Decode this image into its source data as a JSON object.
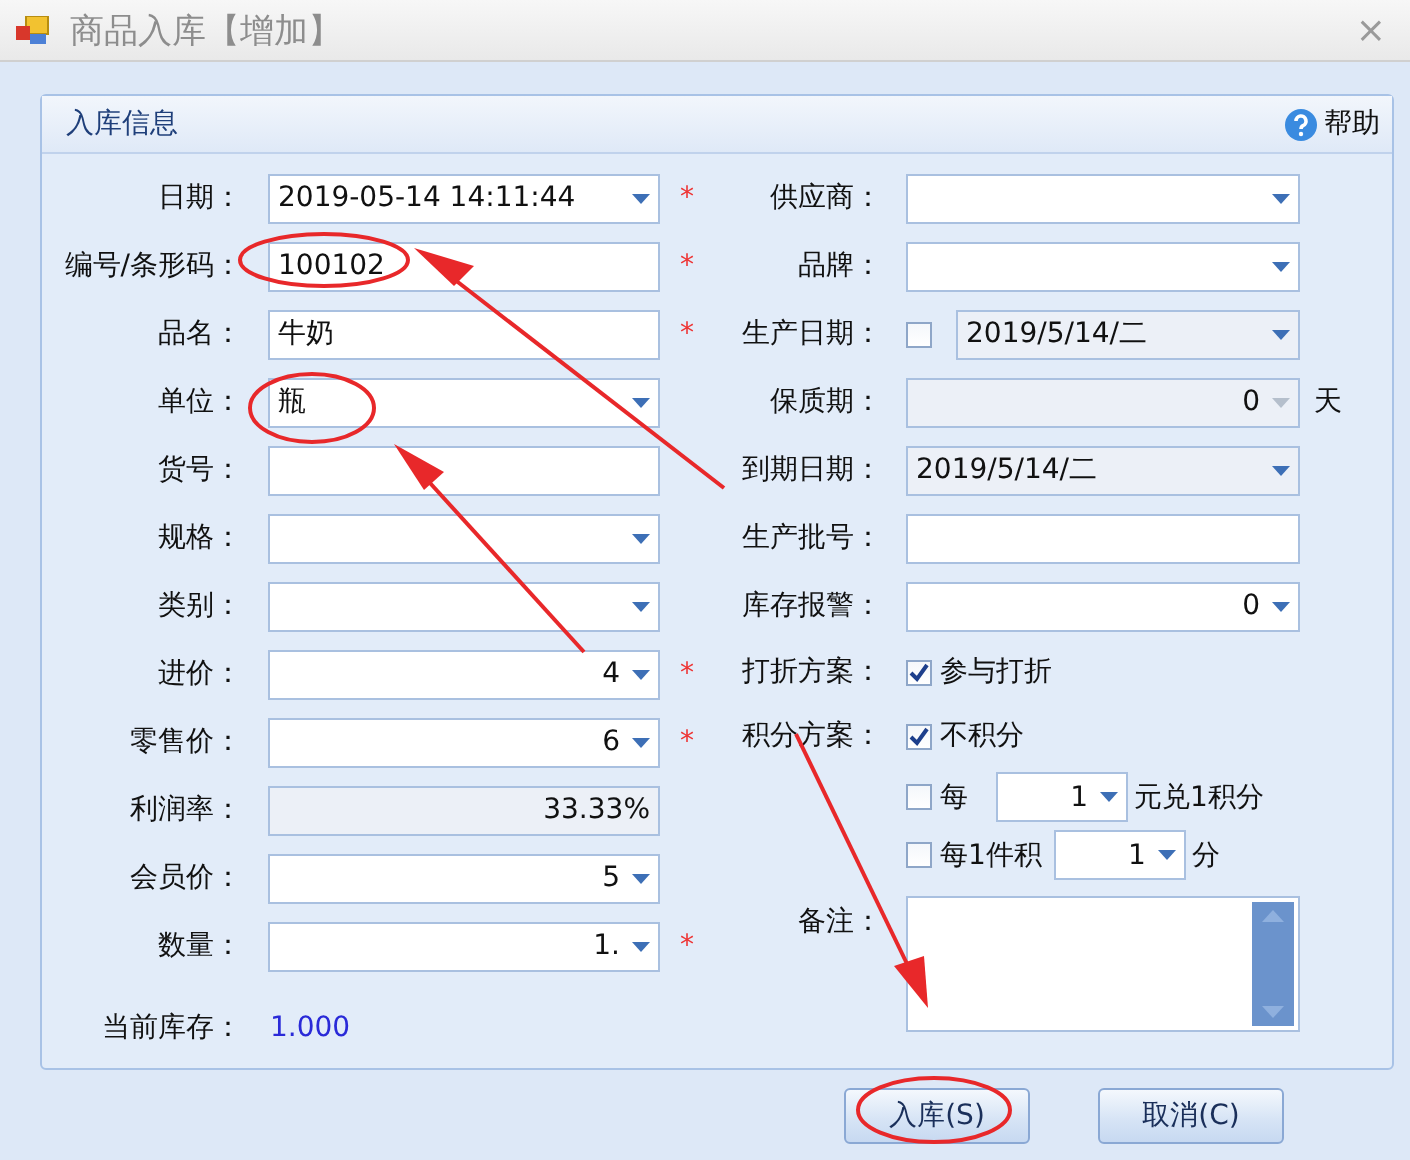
{
  "window": {
    "title": "商品入库【增加】",
    "close": "×"
  },
  "panel": {
    "title": "入库信息",
    "help": "帮助"
  },
  "left_fields": [
    {
      "label": "日期：",
      "kind": "combo",
      "value": "2019-05-14 14:11:44",
      "required_mark": "*"
    },
    {
      "label": "编号/条形码：",
      "kind": "text",
      "value": "100102",
      "required_mark": "*"
    },
    {
      "label": "品名：",
      "kind": "text",
      "value": "牛奶",
      "required_mark": "*"
    },
    {
      "label": "单位：",
      "kind": "combo",
      "value": "瓶"
    },
    {
      "label": "货号：",
      "kind": "text"
    },
    {
      "label": "规格：",
      "kind": "combo"
    },
    {
      "label": "类别：",
      "kind": "combo"
    },
    {
      "label": "进价：",
      "kind": "number",
      "value": "4",
      "required_mark": "*"
    },
    {
      "label": "零售价：",
      "kind": "number",
      "value": "6",
      "required_mark": "*"
    },
    {
      "label": "利润率：",
      "kind": "readonly",
      "value": "33.33%"
    },
    {
      "label": "会员价：",
      "kind": "number",
      "value": "5"
    },
    {
      "label": "数量：",
      "kind": "number",
      "value": "1.",
      "required_mark": "*"
    }
  ],
  "stock": {
    "label": "当前库存：",
    "value": "1.000"
  },
  "right_fields": [
    {
      "label": "供应商：",
      "kind": "combo"
    },
    {
      "label": "品牌：",
      "kind": "combo"
    },
    {
      "label": "生产日期：",
      "kind": "date_check",
      "checked": false,
      "value": "2019/5/14/二",
      "disabled": true
    },
    {
      "label": "保质期：",
      "kind": "number",
      "value": "0",
      "disabled": true,
      "unit": "天"
    },
    {
      "label": "到期日期：",
      "kind": "combo",
      "value": "2019/5/14/二",
      "disabled": true
    },
    {
      "label": "生产批号：",
      "kind": "text"
    },
    {
      "label": "库存报警：",
      "kind": "number",
      "value": "0"
    },
    {
      "label": "打折方案：",
      "kind": "check",
      "option": "参与打折",
      "checked": true
    },
    {
      "label": "积分方案：",
      "kind": "check",
      "option": "不积分",
      "checked": true
    },
    {
      "kind": "points",
      "checked": false,
      "prefix": "每",
      "value": "1",
      "suffix": "元兑1积分"
    },
    {
      "kind": "points",
      "checked": false,
      "prefix": "每1件积",
      "value": "1",
      "suffix": "分"
    },
    {
      "label": "备注：",
      "kind": "memo"
    }
  ],
  "buttons": [
    {
      "label": "入库(S)"
    },
    {
      "label": "取消(C)"
    }
  ]
}
